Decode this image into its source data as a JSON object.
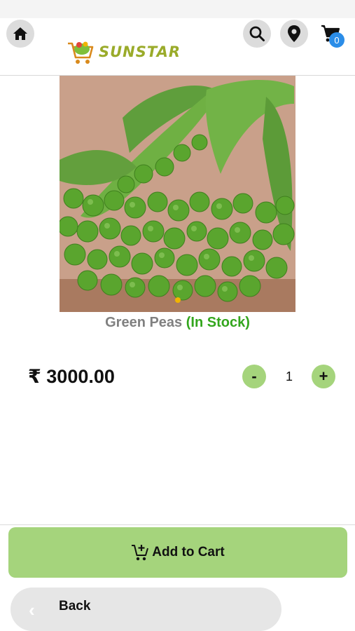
{
  "header": {
    "logo_text": "SUNSTAR",
    "cart_count": "0"
  },
  "product": {
    "name": "Green Peas",
    "stock_status": "(In Stock)",
    "price": "₹ 3000.00",
    "quantity": "1",
    "image_icon": "green-peas-photo"
  },
  "quantity_controls": {
    "minus_label": "-",
    "plus_label": "+"
  },
  "actions": {
    "add_to_cart_label": "Add to Cart",
    "back_label": "Back"
  },
  "icons": {
    "home": "home-icon",
    "search": "search-icon",
    "location": "location-pin-icon",
    "cart": "cart-icon",
    "add_cart": "cart-plus-icon",
    "back": "chevron-left-icon"
  },
  "colors": {
    "accent_green": "#a5d47c",
    "stock_green": "#33a61d",
    "logo_olive": "#9aab2a",
    "badge_blue": "#2b8de8",
    "dot_yellow": "#f0b400"
  }
}
